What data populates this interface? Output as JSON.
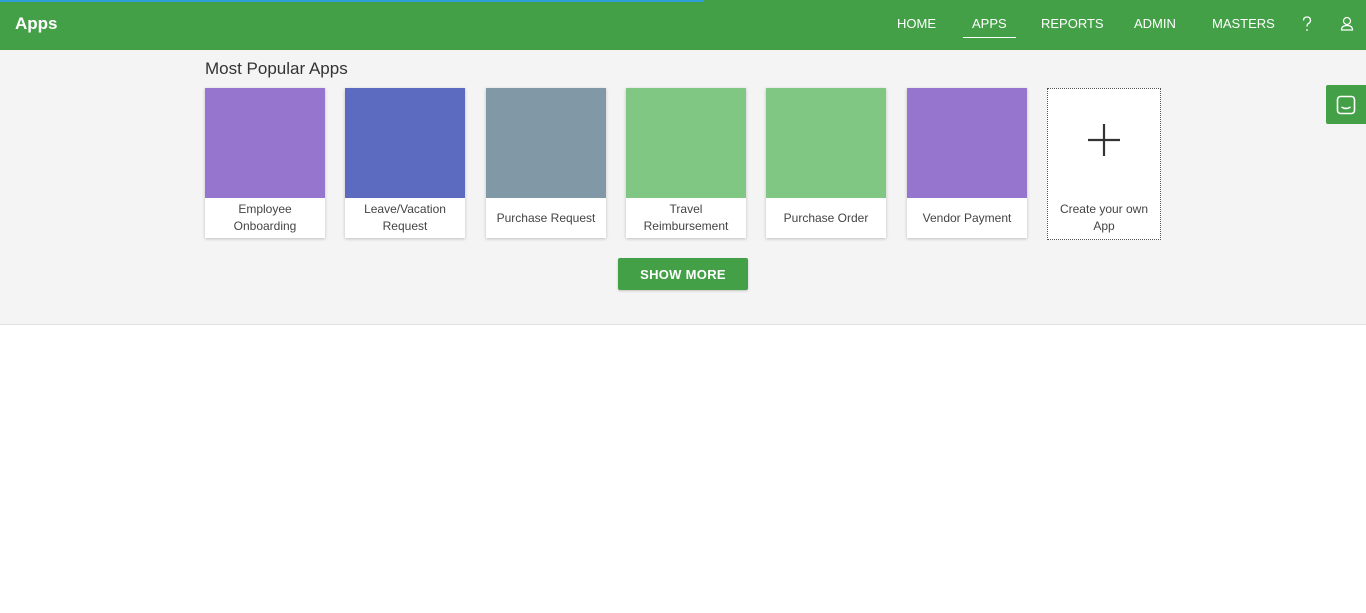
{
  "header": {
    "title": "Apps",
    "nav": [
      {
        "label": "HOME"
      },
      {
        "label": "APPS"
      },
      {
        "label": "REPORTS"
      },
      {
        "label": "ADMIN"
      },
      {
        "label": "MASTERS"
      }
    ],
    "active_tab": "APPS",
    "icons": [
      "help-icon",
      "user-icon"
    ]
  },
  "popular": {
    "title": "Most Popular Apps",
    "apps": [
      {
        "label": "Employee Onboarding",
        "color": "#9575cd"
      },
      {
        "label": "Leave/Vacation Request",
        "color": "#5c6bc0"
      },
      {
        "label": "Purchase Request",
        "color": "#8198a6"
      },
      {
        "label": "Travel Reimbursement",
        "color": "#81c784"
      },
      {
        "label": "Purchase Order",
        "color": "#81c784"
      },
      {
        "label": "Vendor Payment",
        "color": "#9575cd"
      }
    ],
    "create_label": "Create your own App",
    "show_more": "SHOW MORE"
  },
  "chat_widget": {
    "icon": "chat-icon"
  },
  "colors": {
    "brand_green": "#43a047",
    "loading_blue": "#2e9fd8",
    "panel_bg": "#f4f4f4"
  }
}
